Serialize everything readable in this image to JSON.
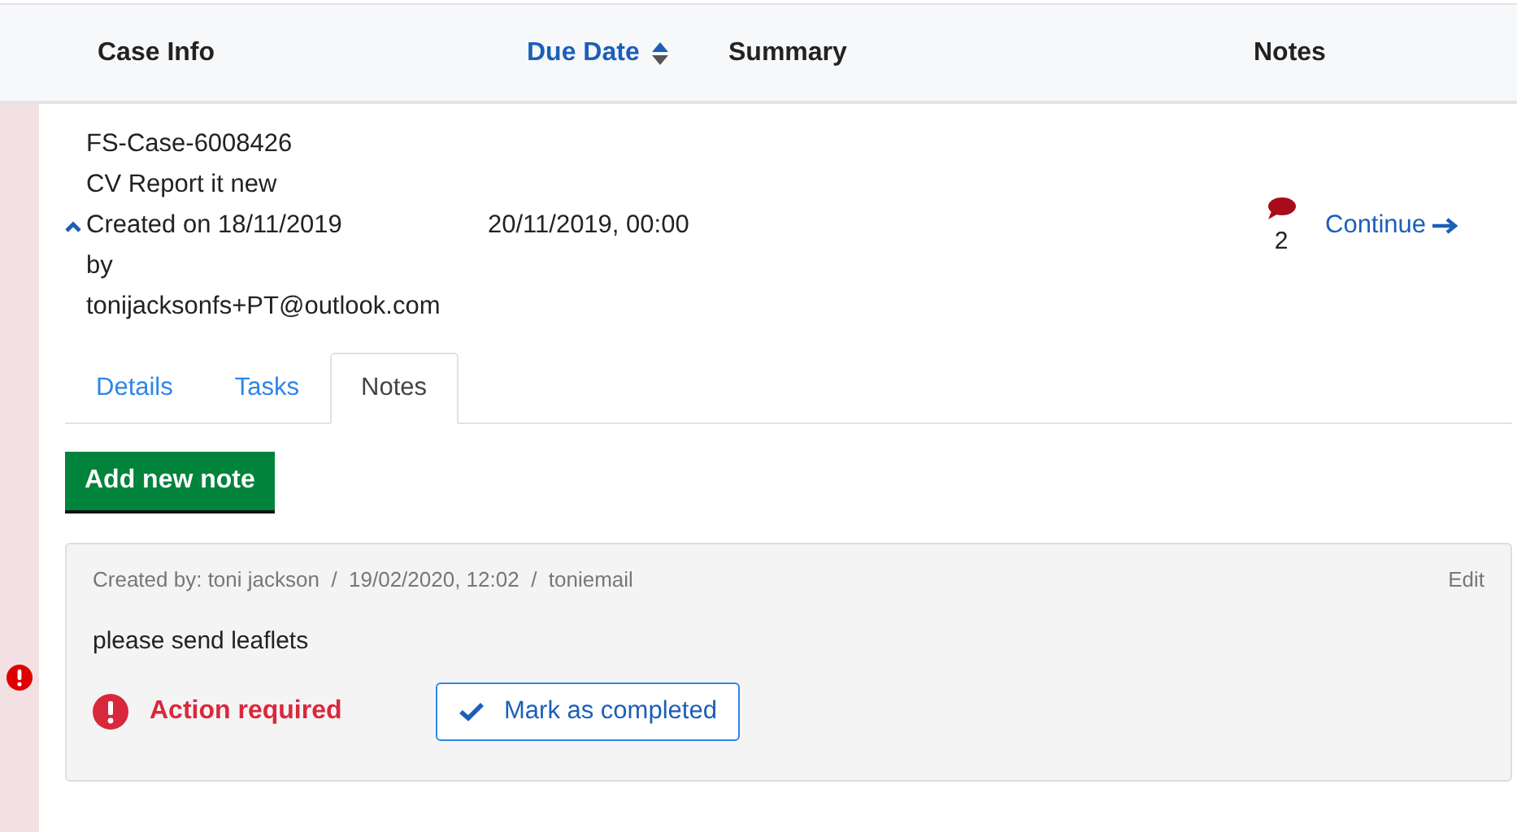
{
  "table": {
    "columns": [
      {
        "label": "Case Info",
        "sorted": false
      },
      {
        "label": "Due Date",
        "sorted": true
      },
      {
        "label": "Summary",
        "sorted": false
      },
      {
        "label": "Notes",
        "sorted": false
      }
    ],
    "rows": [
      {
        "alert": true,
        "expanded": true,
        "case_info": [
          "FS-Case-6008426",
          "CV Report it new",
          "Created on 18/11/2019",
          "by",
          "tonijacksonfs+PT@outlook.com"
        ],
        "due_date": "20/11/2019, 00:00",
        "notes_count": "2",
        "action": "Continue",
        "tabs": [
          {
            "label": "Details",
            "selected": false
          },
          {
            "label": "Tasks",
            "selected": false
          },
          {
            "label": "Notes",
            "selected": true
          }
        ],
        "add_button": "Add new note",
        "notes": [
          {
            "meta": "Created by: toni jackson  /  19/02/2020, 12:02  /  toniemail",
            "edit": "Edit",
            "text": "please send leaflets",
            "action_required": true,
            "status": "Action required",
            "complete_button": "Mark as completed"
          }
        ]
      }
    ]
  }
}
